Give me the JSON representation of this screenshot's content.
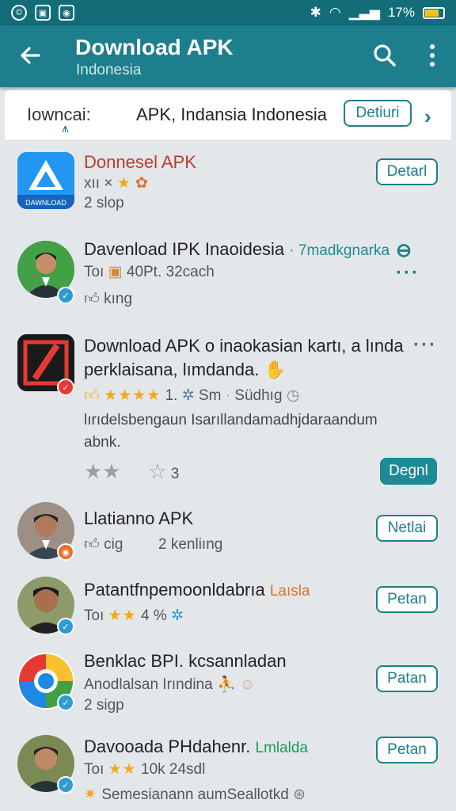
{
  "status_bar": {
    "battery": "17%"
  },
  "appbar": {
    "title": "Download APK",
    "subtitle": "Indonesia"
  },
  "filter": {
    "label": "Iowncai:",
    "value": "APK, Indansia Indonesia",
    "button": "Detiuri"
  },
  "items": [
    {
      "title": "Donnesel APK",
      "meta1": "xıı ×",
      "meta2": "2 slop",
      "button": "Detarl"
    },
    {
      "title": "Davenload IPK Inaoidesia",
      "title_accent": "· 7madkgnarka",
      "meta1": "Toı",
      "meta1b": "40Pt. 32cach",
      "meta2": "kıng"
    },
    {
      "title_line1": "Download APK o inaokasian kartı, a lında",
      "title_line2": "perklaisana, lımdanda.",
      "rating_num": "1.",
      "meta_mid": "Sm",
      "meta_right": "Südhıg",
      "desc_line1": "lırıdelsbengaun Isarıllandamadhjdaraandum",
      "desc_line2": "abnk.",
      "rating_small": "3",
      "button": "Degnl"
    },
    {
      "title": "Llatianno APK",
      "meta1": "cig",
      "meta1b": "2 kenliıng",
      "button": "Netlai"
    },
    {
      "title": "Patantfnpemoonldabrıa",
      "title_accent": "Laısla",
      "meta1": "Toı",
      "meta1b": "4 %",
      "button": "Petan"
    },
    {
      "title": "Benklac BPI. kcsannladan",
      "meta1": "Anodlalsan Irındina",
      "meta2": "2 sigp",
      "button": "Patan"
    },
    {
      "title": "Davooada PHdahenr.",
      "title_accent": "Lmlalda",
      "meta1": "Toı",
      "meta1b": "10k 24sdl",
      "meta2": "Semesianann aumSeallotkd",
      "button": "Petan"
    }
  ]
}
